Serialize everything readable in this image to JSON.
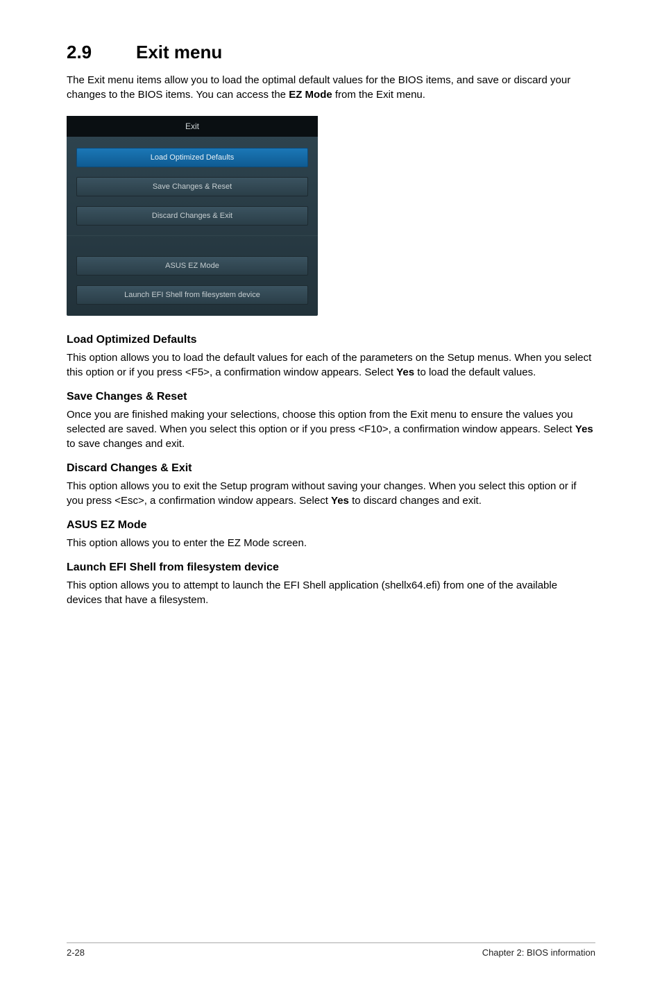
{
  "section": {
    "number": "2.9",
    "title": "Exit menu"
  },
  "intro_parts": {
    "a": "The Exit menu items allow you to load the optimal default values for the BIOS items, and save or discard your changes to the BIOS items. You can access the ",
    "b": "EZ Mode",
    "c": " from the Exit menu."
  },
  "bios": {
    "header": "Exit",
    "items": [
      "Load Optimized Defaults",
      "Save Changes & Reset",
      "Discard Changes & Exit",
      "ASUS EZ Mode",
      "Launch EFI Shell from filesystem device"
    ]
  },
  "blocks": {
    "lod": {
      "h": "Load Optimized Defaults",
      "p_a": "This option allows you to load the default values for each of the parameters on the Setup menus. When you select this option or if you press <F5>, a confirmation window appears. Select ",
      "p_b": "Yes",
      "p_c": " to load the default values."
    },
    "scr": {
      "h": "Save Changes & Reset",
      "p_a": "Once you are finished making your selections, choose this option from the Exit menu to ensure the values you selected are saved. When you select this option or if you press <F10>, a confirmation window appears. Select ",
      "p_b": "Yes",
      "p_c": " to save changes and exit."
    },
    "dce": {
      "h": "Discard Changes & Exit",
      "p_a": "This option allows you to exit the Setup program without saving your changes. When you select this option or if you press <Esc>, a confirmation window appears. Select ",
      "p_b": "Yes",
      "p_c": " to discard changes and exit."
    },
    "ez": {
      "h": "ASUS EZ Mode",
      "p": "This option allows you to enter the EZ Mode screen."
    },
    "efi": {
      "h": "Launch EFI Shell from filesystem device",
      "p": "This option allows you to attempt to launch the EFI Shell application (shellx64.efi) from one of the available devices that have a filesystem."
    }
  },
  "footer": {
    "left": "2-28",
    "right": "Chapter 2: BIOS information"
  }
}
